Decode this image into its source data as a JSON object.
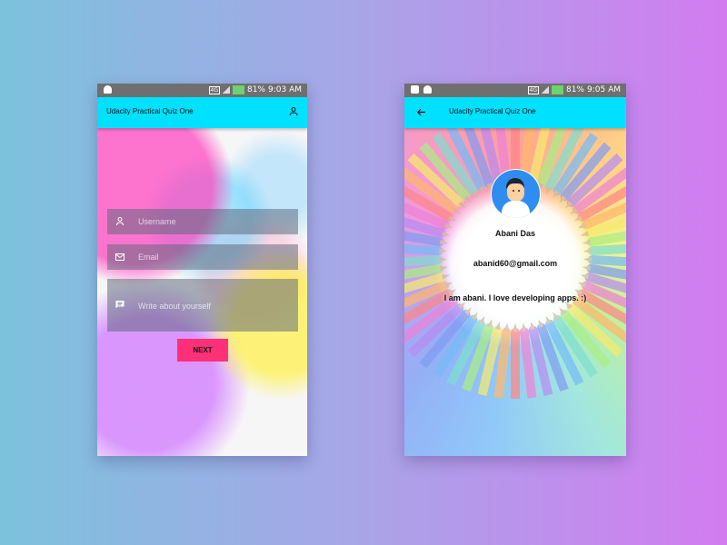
{
  "colors": {
    "toolbar": "#00e0ff",
    "button": "#ff2f78",
    "avatar": "#2f8df0"
  },
  "screens": [
    {
      "status": {
        "network": "4G",
        "battery": "81%",
        "time": "9:03 AM"
      },
      "toolbar": {
        "title": "Udacity Practical Quiz One",
        "action_icon": "person-outline-icon"
      },
      "form": {
        "username_placeholder": "Username",
        "email_placeholder": "Email",
        "about_placeholder": "Write about yourself",
        "next_label": "NEXT"
      }
    },
    {
      "status": {
        "network": "4G",
        "battery": "81%",
        "time": "9:05 AM"
      },
      "toolbar": {
        "title": "Udacity Practical Quiz One",
        "nav_icon": "arrow-back-icon"
      },
      "profile": {
        "name": "Abani Das",
        "email": "abanid60@gmail.com",
        "about": "I am abani. I love developing apps. :)"
      }
    }
  ]
}
